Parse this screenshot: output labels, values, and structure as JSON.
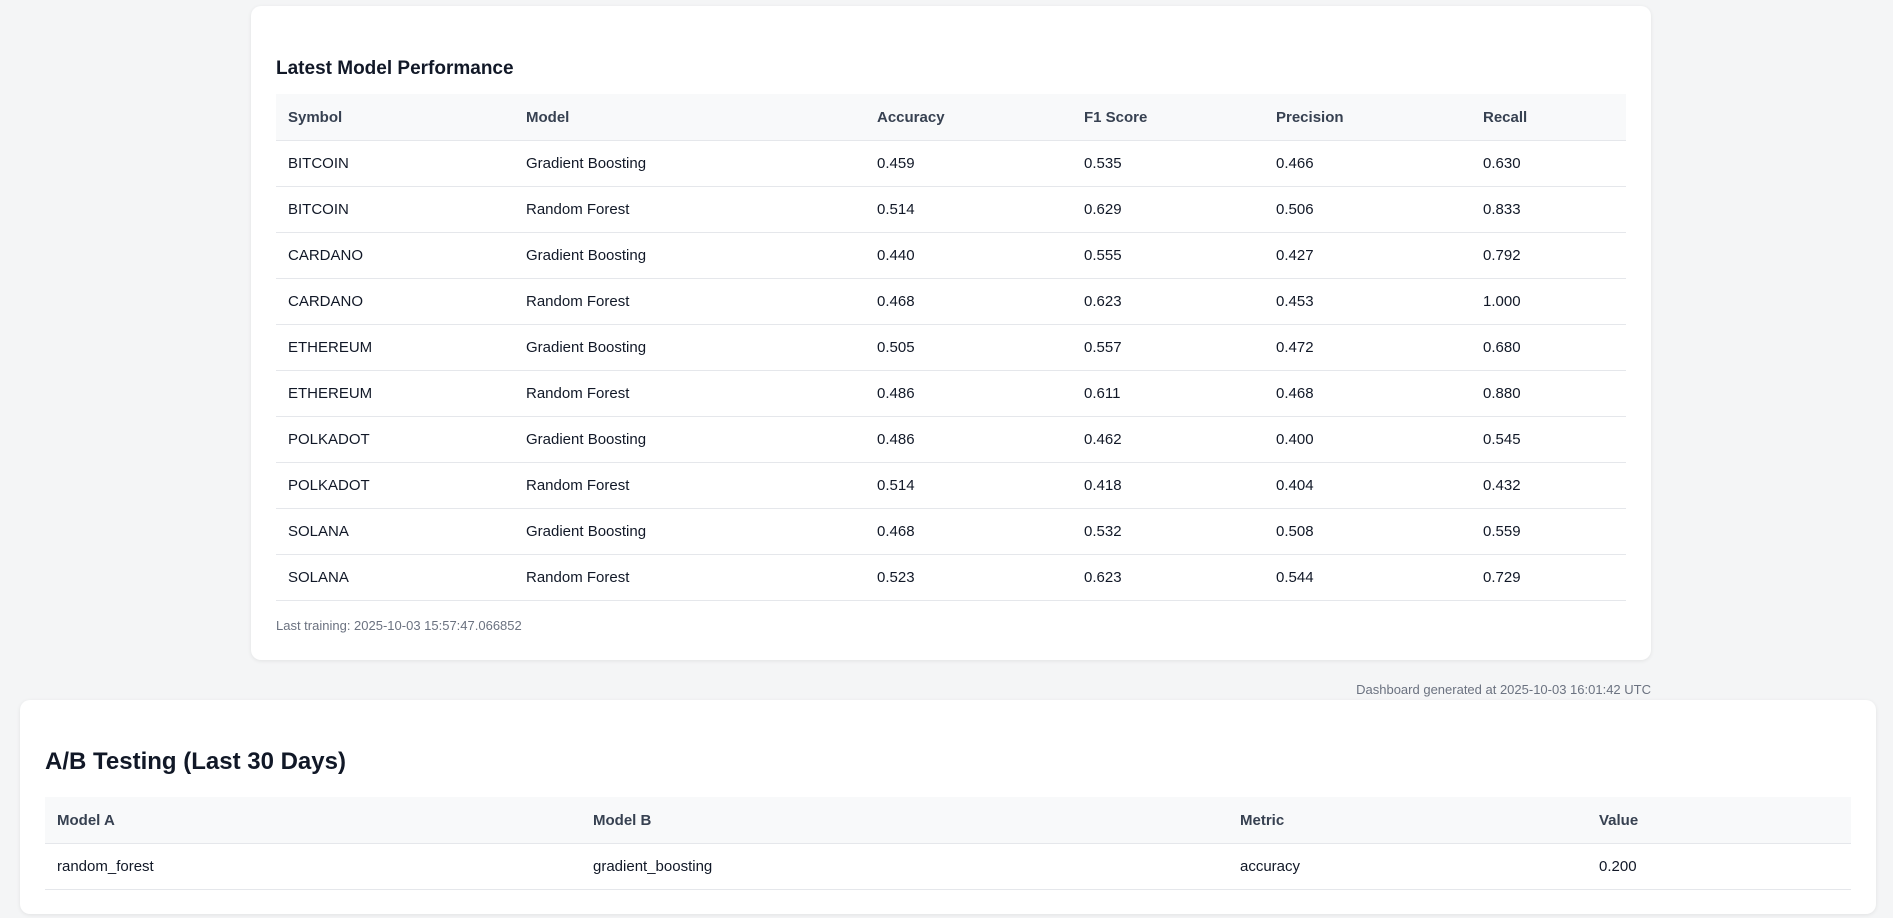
{
  "performance": {
    "title": "Latest Model Performance",
    "columns": [
      "Symbol",
      "Model",
      "Accuracy",
      "F1 Score",
      "Precision",
      "Recall"
    ],
    "rows": [
      [
        "BITCOIN",
        "Gradient Boosting",
        "0.459",
        "0.535",
        "0.466",
        "0.630"
      ],
      [
        "BITCOIN",
        "Random Forest",
        "0.514",
        "0.629",
        "0.506",
        "0.833"
      ],
      [
        "CARDANO",
        "Gradient Boosting",
        "0.440",
        "0.555",
        "0.427",
        "0.792"
      ],
      [
        "CARDANO",
        "Random Forest",
        "0.468",
        "0.623",
        "0.453",
        "1.000"
      ],
      [
        "ETHEREUM",
        "Gradient Boosting",
        "0.505",
        "0.557",
        "0.472",
        "0.680"
      ],
      [
        "ETHEREUM",
        "Random Forest",
        "0.486",
        "0.611",
        "0.468",
        "0.880"
      ],
      [
        "POLKADOT",
        "Gradient Boosting",
        "0.486",
        "0.462",
        "0.400",
        "0.545"
      ],
      [
        "POLKADOT",
        "Random Forest",
        "0.514",
        "0.418",
        "0.404",
        "0.432"
      ],
      [
        "SOLANA",
        "Gradient Boosting",
        "0.468",
        "0.532",
        "0.508",
        "0.559"
      ],
      [
        "SOLANA",
        "Random Forest",
        "0.523",
        "0.623",
        "0.544",
        "0.729"
      ]
    ],
    "last_training": "Last training: 2025-10-03 15:57:47.066852"
  },
  "generated_text": "Dashboard generated at 2025-10-03 16:01:42 UTC",
  "ab_testing": {
    "title": "A/B Testing (Last 30 Days)",
    "columns": [
      "Model A",
      "Model B",
      "Metric",
      "Value"
    ],
    "rows": [
      [
        "random_forest",
        "gradient_boosting",
        "accuracy",
        "0.200"
      ]
    ]
  },
  "colors": {
    "background": "#f4f5f6",
    "card": "#ffffff",
    "header_row": "#f8f9fa",
    "muted_text": "#6b7280"
  }
}
